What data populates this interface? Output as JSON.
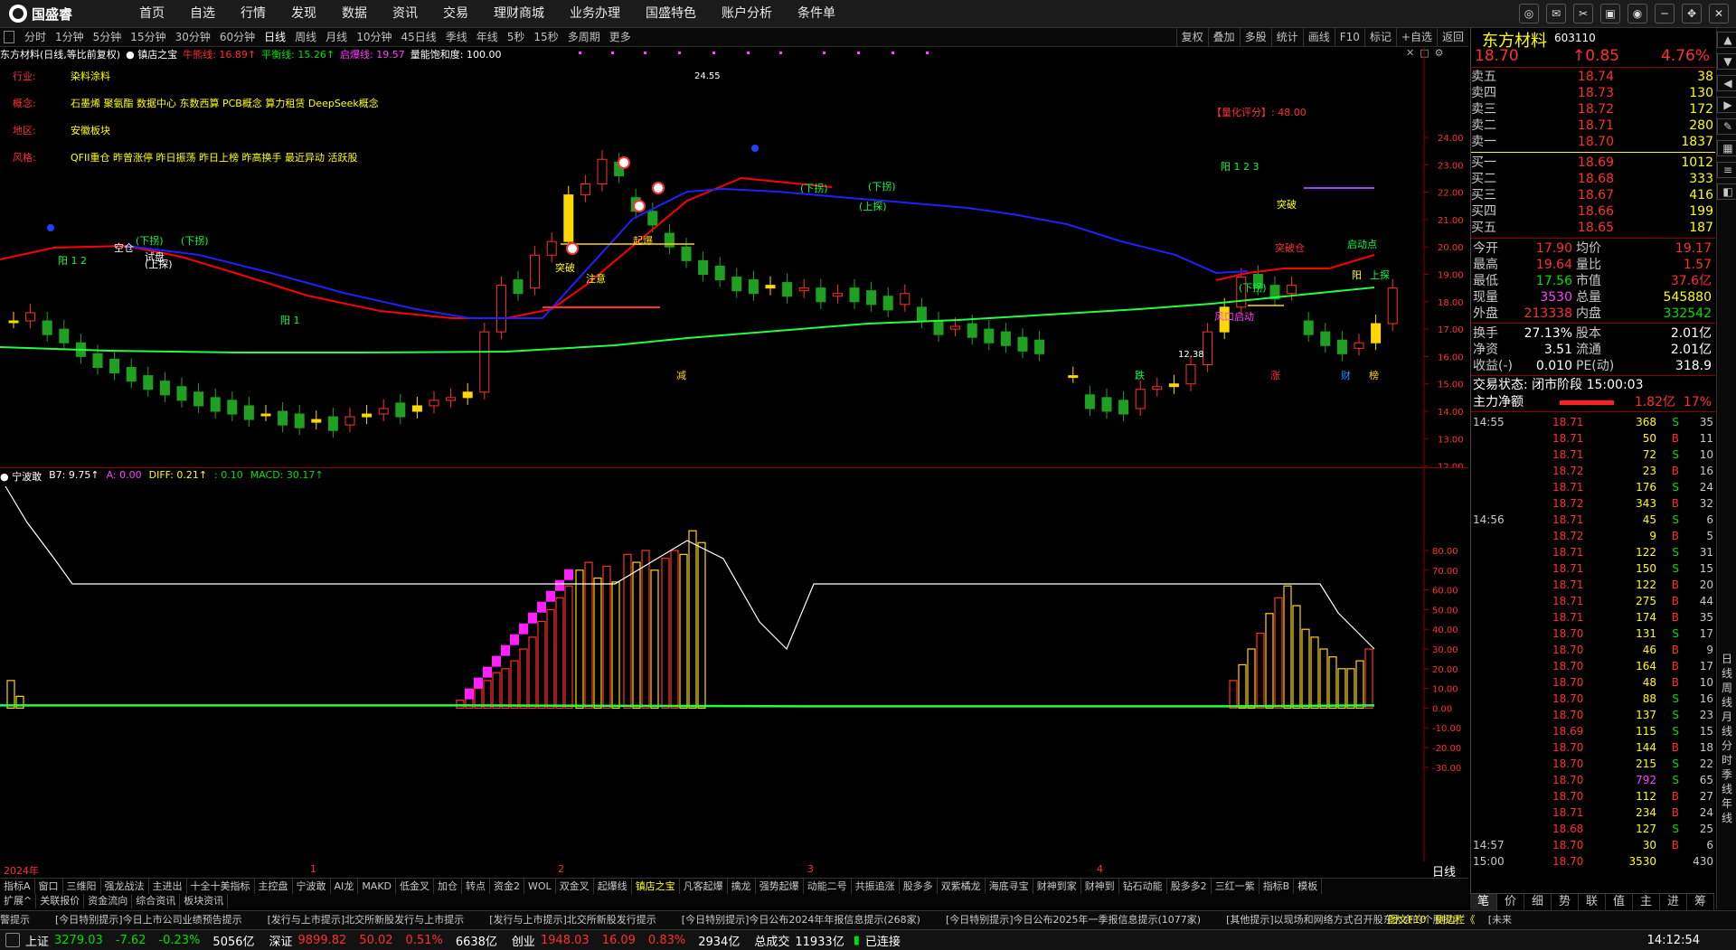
{
  "app": {
    "logo": "国盛睿"
  },
  "menu": [
    "首页",
    "自选",
    "行情",
    "发现",
    "数据",
    "资讯",
    "交易",
    "理财商城",
    "业务办理",
    "国盛特色",
    "账户分析",
    "条件单"
  ],
  "periods": [
    "分时",
    "1分钟",
    "5分钟",
    "15分钟",
    "30分钟",
    "60分钟",
    "日线",
    "周线",
    "月线",
    "10分钟",
    "45日线",
    "季线",
    "年线",
    "5秒",
    "15秒",
    "多周期",
    "更多"
  ],
  "active_period": "日线",
  "tools_right": [
    "复权",
    "叠加",
    "多股",
    "统计",
    "画线",
    "F10",
    "标记",
    "+自选",
    "返回"
  ],
  "chart_head": {
    "title": "东方材料(日线,等比前复权)",
    "indicator": "镇店之宝",
    "l1": "牛熊线: 16.89↑",
    "l2": "平衡线: 15.26↑",
    "l3": "启爆线: 19.57",
    "l4": "量能饱和度: 100.00"
  },
  "info": [
    {
      "k": "行业:",
      "v": "染料涂料"
    },
    {
      "k": "概念:",
      "v": "石墨烯 聚氨酯 数据中心 东数西算 PCB概念 算力租赁 DeepSeek概念"
    },
    {
      "k": "地区:",
      "v": "安徽板块"
    },
    {
      "k": "风格:",
      "v": "QFII重仓 昨曾涨停 昨日振荡 昨日上榜 昨高换手 最近异动 活跃股"
    }
  ],
  "score_text": "【量化评分】: 48.00",
  "price_axis": [
    "24.00",
    "23.00",
    "22.00",
    "21.00",
    "20.00",
    "19.00",
    "18.00",
    "17.00",
    "16.00",
    "15.00",
    "14.00",
    "13.00",
    "12.00"
  ],
  "annotations": {
    "high": "24.55",
    "low": "12.38",
    "signals": [
      "(下拐)",
      "(下拐)",
      "空仓",
      "试盘",
      "阳 1 2",
      "阳 1",
      "(上探)",
      "突破",
      "注意",
      "起爆",
      "(下拐)",
      "(下拐)",
      "(上探)",
      "突破",
      "阳 1 2 3",
      "突破仓",
      "风口启动",
      "启动点",
      "(下拐)",
      "阳",
      "上探",
      "减",
      "跌",
      "涨",
      "财",
      "榜"
    ]
  },
  "macd_head": {
    "name": "宁波敢",
    "b7": "B7: 9.75↑",
    "a": "A: 0.00",
    "diff": "DIFF: 0.21↑",
    "dea": ": 0.10",
    "macd": "MACD: 30.17↑"
  },
  "macd_axis": [
    "80.00",
    "70.00",
    "60.00",
    "50.00",
    "40.00",
    "30.00",
    "20.00",
    "10.00",
    "0.00",
    "-10.00",
    "-20.00",
    "-30.00"
  ],
  "x_axis": {
    "year": "2024年",
    "months": [
      "1",
      "2",
      "3",
      "4"
    ],
    "mode": "日线"
  },
  "tabs": [
    "指标A",
    "窗口",
    "三维阳",
    "强龙战法",
    "主进出",
    "十全十美指标",
    "主控盘",
    "宁波敢",
    "AI龙",
    "MAKD",
    "低金叉",
    "加仓",
    "转点",
    "资金2",
    "WOL",
    "双金叉",
    "起爆线",
    "镇店之宝",
    "凡客起爆",
    "擒龙",
    "强势起爆",
    "动能二号",
    "共振追涨",
    "股多多",
    "双紫橘龙",
    "海底寻宝",
    "财神到家",
    "财神到",
    "钻石动能",
    "股多多2",
    "三红一紫",
    "指标B",
    "模板"
  ],
  "active_tab": "镇店之宝",
  "tabs2": [
    "扩展^",
    "关联报价",
    "资金流向",
    "综合资讯",
    "板块资讯"
  ],
  "news": [
    "警提示",
    "[今日特别提示]今日上市公司业绩预告提示",
    "[发行与上市提示]北交所新股发行与上市提示",
    "[发行与上市提示]北交所新股发行提示",
    "[今日特别提示]今日公布2024年年报信息提示(268家)",
    "[今日特别提示]今日公布2025年一季报信息提示(1077家)",
    "[其他提示]以现场和网络方式召开股东大会的个股提示",
    "[未来"
  ],
  "news_right": [
    "图文F10",
    "侧边栏《"
  ],
  "status": {
    "sh": {
      "name": "上证",
      "val": "3279.03",
      "chg": "-7.62",
      "pct": "-0.23%",
      "amt": "5056亿"
    },
    "sz": {
      "name": "深证",
      "val": "9899.82",
      "chg": "50.02",
      "pct": "0.51%",
      "amt": "6638亿"
    },
    "cy": {
      "name": "创业",
      "val": "1948.03",
      "chg": "16.09",
      "pct": "0.83%",
      "amt": "2934亿"
    },
    "total_label": "总成交",
    "total": "11933亿",
    "conn": "已连接",
    "time": "14:12:54"
  },
  "quote": {
    "name": "东方材料",
    "code": "603110",
    "price": "18.70",
    "change": "↑0.85",
    "pct": "4.76%",
    "asks": [
      {
        "l": "卖五",
        "p": "18.74",
        "v": "38"
      },
      {
        "l": "卖四",
        "p": "18.73",
        "v": "130"
      },
      {
        "l": "卖三",
        "p": "18.72",
        "v": "172"
      },
      {
        "l": "卖二",
        "p": "18.71",
        "v": "280"
      },
      {
        "l": "卖一",
        "p": "18.70",
        "v": "1837"
      }
    ],
    "bids": [
      {
        "l": "买一",
        "p": "18.69",
        "v": "1012"
      },
      {
        "l": "买二",
        "p": "18.68",
        "v": "333"
      },
      {
        "l": "买三",
        "p": "18.67",
        "v": "416"
      },
      {
        "l": "买四",
        "p": "18.66",
        "v": "199"
      },
      {
        "l": "买五",
        "p": "18.65",
        "v": "187"
      }
    ],
    "stats": [
      {
        "l1": "今开",
        "v1": "17.90",
        "l2": "均价",
        "v2": "19.17"
      },
      {
        "l1": "最高",
        "v1": "19.64",
        "l2": "量比",
        "v2": "1.57"
      },
      {
        "l1": "最低",
        "v1": "17.56",
        "l2": "市值",
        "v2": "37.6亿"
      },
      {
        "l1": "现量",
        "v1": "3530",
        "l2": "总量",
        "v2": "545880"
      },
      {
        "l1": "外盘",
        "v1": "213338",
        "l2": "内盘",
        "v2": "332542"
      }
    ],
    "stats2": [
      {
        "l1": "换手",
        "v1": "27.13%",
        "l2": "股本",
        "v2": "2.01亿"
      },
      {
        "l1": "净资",
        "v1": "3.51",
        "l2": "流通",
        "v2": "2.01亿"
      },
      {
        "l1": "收益(-)",
        "v1": "0.010",
        "l2": "PE(动)",
        "v2": "318.9"
      }
    ],
    "trade_status": "交易状态: 闭市阶段 15:00:03",
    "net_label": "主力净额",
    "net_val": "1.82亿",
    "net_pct": "17%"
  },
  "ticks": [
    {
      "t": "14:55",
      "p": "18.71",
      "v": "368",
      "bs": "S",
      "n": "35"
    },
    {
      "t": "",
      "p": "18.71",
      "v": "50",
      "bs": "B",
      "n": "11"
    },
    {
      "t": "",
      "p": "18.71",
      "v": "72",
      "bs": "S",
      "n": "10"
    },
    {
      "t": "",
      "p": "18.72",
      "v": "23",
      "bs": "B",
      "n": "16"
    },
    {
      "t": "",
      "p": "18.71",
      "v": "176",
      "bs": "S",
      "n": "24"
    },
    {
      "t": "",
      "p": "18.72",
      "v": "343",
      "bs": "B",
      "n": "32"
    },
    {
      "t": "14:56",
      "p": "18.71",
      "v": "45",
      "bs": "S",
      "n": "6"
    },
    {
      "t": "",
      "p": "18.72",
      "v": "9",
      "bs": "B",
      "n": "5"
    },
    {
      "t": "",
      "p": "18.71",
      "v": "122",
      "bs": "S",
      "n": "31"
    },
    {
      "t": "",
      "p": "18.71",
      "v": "150",
      "bs": "S",
      "n": "15"
    },
    {
      "t": "",
      "p": "18.71",
      "v": "122",
      "bs": "B",
      "n": "20"
    },
    {
      "t": "",
      "p": "18.71",
      "v": "275",
      "bs": "B",
      "n": "44"
    },
    {
      "t": "",
      "p": "18.71",
      "v": "174",
      "bs": "B",
      "n": "35"
    },
    {
      "t": "",
      "p": "18.70",
      "v": "131",
      "bs": "S",
      "n": "17"
    },
    {
      "t": "",
      "p": "18.70",
      "v": "46",
      "bs": "B",
      "n": "9"
    },
    {
      "t": "",
      "p": "18.70",
      "v": "164",
      "bs": "B",
      "n": "17"
    },
    {
      "t": "",
      "p": "18.70",
      "v": "48",
      "bs": "B",
      "n": "10"
    },
    {
      "t": "",
      "p": "18.70",
      "v": "88",
      "bs": "S",
      "n": "16"
    },
    {
      "t": "",
      "p": "18.70",
      "v": "137",
      "bs": "S",
      "n": "23"
    },
    {
      "t": "",
      "p": "18.69",
      "v": "115",
      "bs": "S",
      "n": "15"
    },
    {
      "t": "",
      "p": "18.70",
      "v": "144",
      "bs": "B",
      "n": "18"
    },
    {
      "t": "",
      "p": "18.70",
      "v": "215",
      "bs": "S",
      "n": "22"
    },
    {
      "t": "",
      "p": "18.70",
      "v": "792",
      "bs": "S",
      "n": "65"
    },
    {
      "t": "",
      "p": "18.70",
      "v": "112",
      "bs": "B",
      "n": "27"
    },
    {
      "t": "",
      "p": "18.71",
      "v": "234",
      "bs": "B",
      "n": "24"
    },
    {
      "t": "",
      "p": "18.68",
      "v": "127",
      "bs": "S",
      "n": "25"
    },
    {
      "t": "14:57",
      "p": "18.70",
      "v": "30",
      "bs": "B",
      "n": "6"
    },
    {
      "t": "15:00",
      "p": "18.70",
      "v": "3530",
      "bs": "",
      "n": "430"
    }
  ],
  "rp_tabs": [
    "笔",
    "价",
    "细",
    "势",
    "联",
    "值",
    "主",
    "进",
    "筹"
  ],
  "vtabs": [
    "日",
    "线",
    "周",
    "线",
    "月",
    "线",
    "分",
    "时",
    "季",
    "线",
    "年",
    "线"
  ],
  "colors": {
    "up": "#ff3030",
    "down": "#00e000",
    "bg": "#000000",
    "ma_red": "#ff0000",
    "ma_blue": "#2020ff",
    "ma_green": "#20ff40"
  }
}
